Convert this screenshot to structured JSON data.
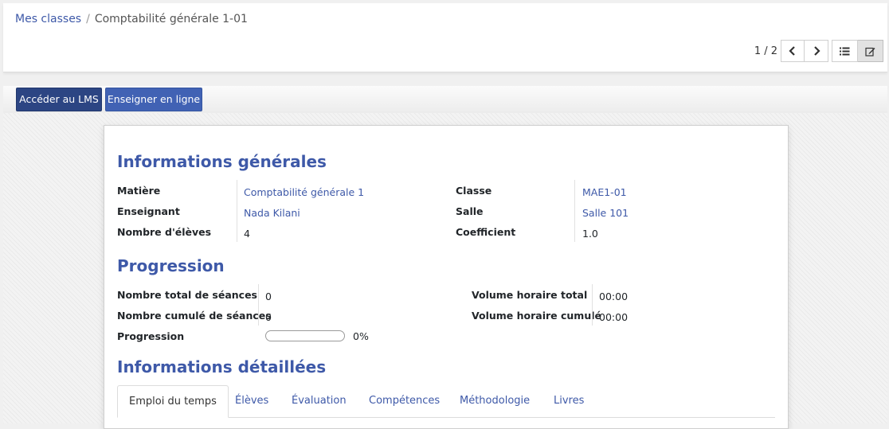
{
  "breadcrumb": {
    "parent": "Mes classes",
    "separator": "/",
    "current": "Comptabilité générale 1-01"
  },
  "pager": {
    "value": "1 / 2"
  },
  "icons": {
    "prev": "chevron-left-icon",
    "next": "chevron-right-icon",
    "list_view": "list-icon",
    "form_view": "edit-icon"
  },
  "buttons": {
    "lms": "Accéder au LMS",
    "online": "Enseigner en ligne"
  },
  "sections": {
    "general": "Informations générales",
    "progression": "Progression",
    "details": "Informations détaillées"
  },
  "general": {
    "matiere_label": "Matière",
    "matiere_value": "Comptabilité générale 1",
    "enseignant_label": "Enseignant",
    "enseignant_value": "Nada Kilani",
    "eleves_label": "Nombre d'élèves",
    "eleves_value": "4",
    "classe_label": "Classe",
    "classe_value": "MAE1-01",
    "salle_label": "Salle",
    "salle_value": "Salle 101",
    "coef_label": "Coefficient",
    "coef_value": "1.0"
  },
  "progression": {
    "total_seances_label": "Nombre total de séances",
    "total_seances_value": "0",
    "cumul_seances_label": "Nombre cumulé de séances",
    "cumul_seances_value": "0",
    "progression_label": "Progression",
    "progression_percent": "0%",
    "progression_fraction": 0,
    "volume_total_label": "Volume horaire total",
    "volume_total_value": "00:00",
    "volume_cumul_label": "Volume horaire cumulé",
    "volume_cumul_value": "00:00"
  },
  "tabs": [
    "Emploi du temps",
    "Élèves",
    "Évaluation",
    "Compétences",
    "Méthodologie",
    "Livres"
  ],
  "colors": {
    "link": "#3e59a8",
    "btn_lms": "#2c4583",
    "btn_online": "#4162b4"
  }
}
